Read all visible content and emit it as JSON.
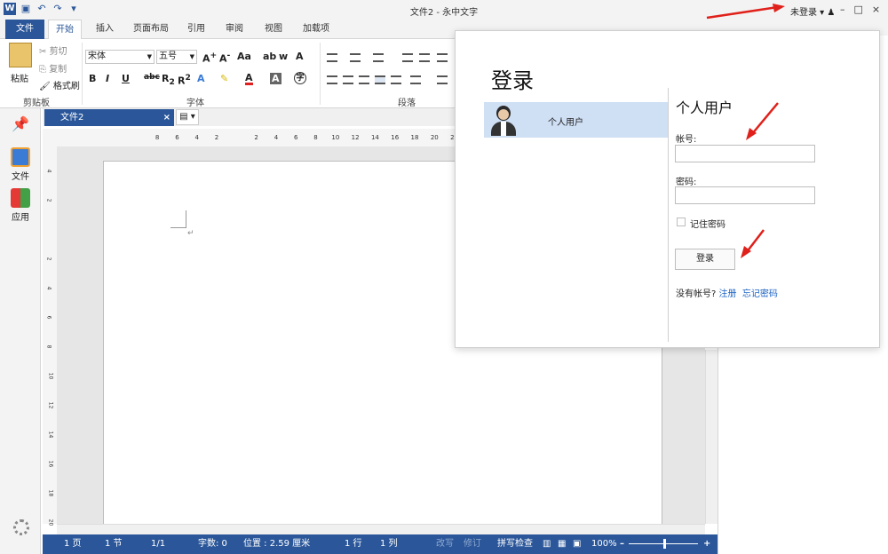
{
  "titlebar": {
    "title": "文件2 - 永中文字",
    "login_status": "未登录",
    "minimize": "–",
    "maximize": "□",
    "close": "×"
  },
  "ribbon_tabs": [
    "文件",
    "开始",
    "插入",
    "页面布局",
    "引用",
    "审阅",
    "视图",
    "加载项"
  ],
  "ribbon": {
    "clipboard": {
      "paste": "粘贴",
      "cut": "剪切",
      "copy": "复制",
      "format_painter": "格式刷",
      "group_label": "剪贴板"
    },
    "font": {
      "font_name": "宋体",
      "font_size": "五号",
      "group_label": "字体"
    },
    "paragraph": {
      "group_label": "段落"
    }
  },
  "sidebar": {
    "file": "文件",
    "apps": "应用"
  },
  "doc_tab": {
    "name": "文件2",
    "close": "×"
  },
  "hruler_ticks": [
    "8",
    "6",
    "4",
    "2",
    "",
    "2",
    "4",
    "6",
    "8",
    "10",
    "12",
    "14",
    "16",
    "18",
    "20",
    "22",
    "24",
    "26"
  ],
  "vruler_ticks": [
    "4",
    "2",
    "",
    "2",
    "4",
    "6",
    "8",
    "10",
    "12",
    "14",
    "16",
    "18",
    "20"
  ],
  "statusbar": {
    "page": "1 页",
    "section": "1 节",
    "pages": "1/1",
    "word_count": "字数: 0",
    "position": "位置 : 2.59 厘米",
    "line": "1 行",
    "column": "1 列",
    "revise": "改写",
    "track": "修订",
    "spellcheck": "拼写检查",
    "zoom": "100%",
    "zoom_minus": "–",
    "zoom_plus": "+"
  },
  "login_dialog": {
    "title": "登录",
    "user_type": "个人用户",
    "form_title": "个人用户",
    "account_label": "帐号:",
    "account_value": "",
    "password_label": "密码:",
    "password_value": "",
    "remember_label": "记住密码",
    "login_button": "登录",
    "no_account": "没有帐号?",
    "register_link": "注册",
    "forgot_link": "忘记密码"
  },
  "colors": {
    "accent": "#2b579a",
    "annotation": "#e0201a",
    "selected_user": "#cfdff4"
  }
}
